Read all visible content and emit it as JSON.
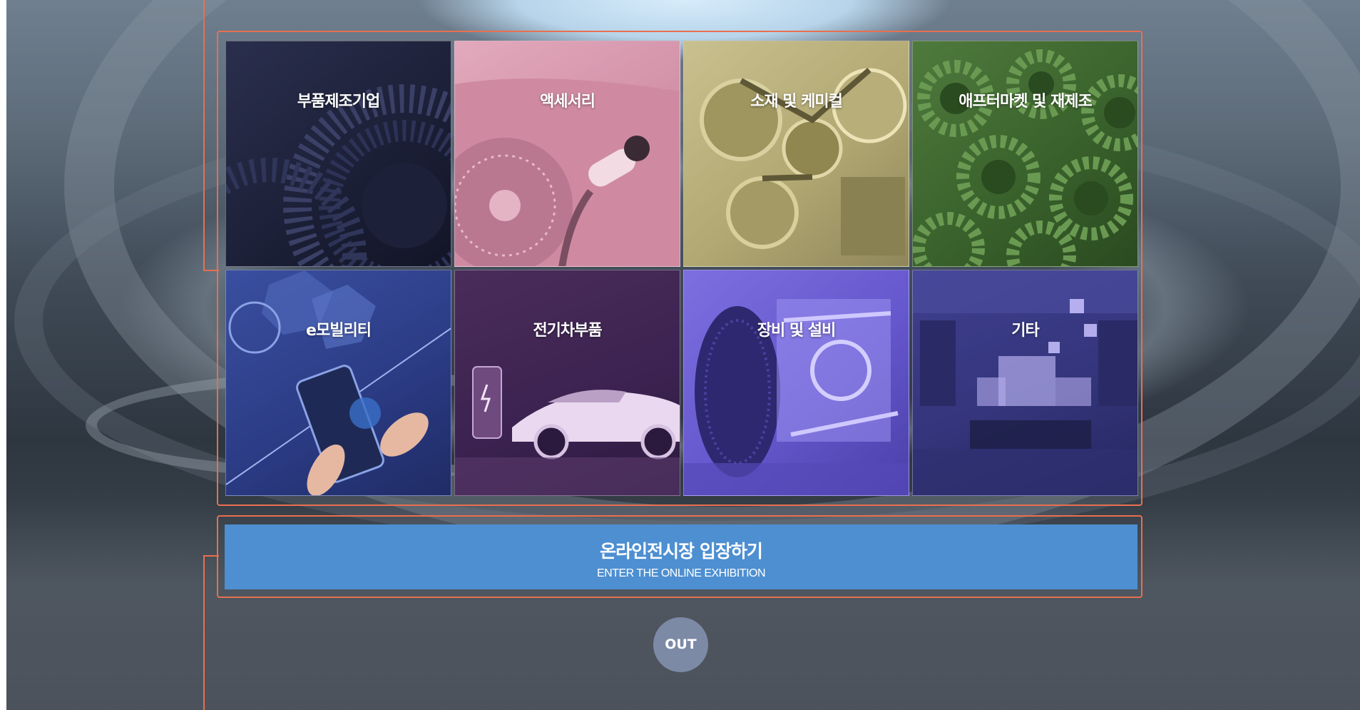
{
  "categories": [
    {
      "label": "부품제조기업"
    },
    {
      "label": "액세서리"
    },
    {
      "label": "소재 및 케미컬"
    },
    {
      "label": "애프터마켓 및 재제조"
    },
    {
      "label": "e모빌리티"
    },
    {
      "label": "전기차부품"
    },
    {
      "label": "장비 및 설비"
    },
    {
      "label": "기타"
    }
  ],
  "enter": {
    "title": "온라인전시장 입장하기",
    "subtitle": "ENTER THE ONLINE EXHIBITION"
  },
  "out": {
    "label": "OUT"
  },
  "colors": {
    "accent_frame": "#e8704f",
    "enter_button": "#4d8fd1",
    "out_button": "#7d8aa6"
  }
}
